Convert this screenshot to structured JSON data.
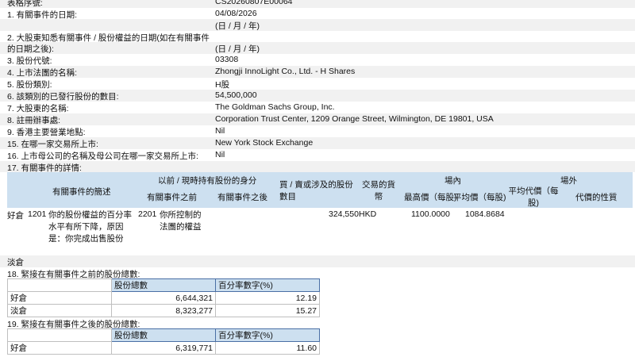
{
  "header_rows": [
    {
      "label": "表格序號:",
      "value": "CS20260807E00064"
    },
    {
      "label": "1. 有關事件的日期:",
      "value": "04/08/2026"
    },
    {
      "label": "",
      "value": "(日 / 月 / 年)"
    },
    {
      "label": "2. 大股東知悉有關事件 / 股份權益的日期(如在有關事件",
      "value": ""
    },
    {
      "label": "的日期之後):",
      "value": "(日 / 月 / 年)"
    },
    {
      "label": "3. 股份代號:",
      "value": "03308"
    },
    {
      "label": "4. 上市法團的名稱:",
      "value": "Zhongji InnoLight Co., Ltd. - H Shares"
    },
    {
      "label": "5. 股份類別:",
      "value": "H股"
    },
    {
      "label": "6. 該類別的已發行股份的數目:",
      "value": "54,500,000"
    },
    {
      "label": "7. 大股東的名稱:",
      "value": "The Goldman Sachs Group, Inc."
    },
    {
      "label": "8. 註冊辦事處:",
      "value": "Corporation Trust Center, 1209 Orange Street, Wilmington, DE 19801, USA"
    },
    {
      "label": "9. 香港主要營業地點:",
      "value": "Nil"
    },
    {
      "label": "15. 在哪一家交易所上市:",
      "value": "New York Stock Exchange"
    },
    {
      "label": "16. 上市母公司的名稱及母公司在哪一家交易所上市:",
      "value": "Nil"
    },
    {
      "label": "17. 有關事件的詳情:",
      "value": ""
    }
  ],
  "events_table": {
    "headers": {
      "desc": "有關事件的簡述",
      "capacity_group": "以前 / 現時持有股份的身分",
      "before": "有關事件之前",
      "after": "有關事件之後",
      "shares": "買 / 賣或涉及的股份數目",
      "currency": "交易的貨幣",
      "on_exchange": "場內",
      "high_price": "最高價（每股)",
      "avg_price": "平均價（每股)",
      "off_exchange": "場外",
      "off_avg": "平均代價（每股)",
      "consideration": "代價的性質"
    },
    "row": {
      "position": "好倉",
      "code1": "1201",
      "desc": "你的股份權益的百分率水平有所下降，原因是：你完成出售股份",
      "code2": "2201",
      "capacity": "你所控制的法團的權益",
      "shares": "324,550",
      "currency": "HKD",
      "high": "1100.0000",
      "avg": "1084.8684"
    },
    "short_label": "淡倉"
  },
  "section18": {
    "title": "18. 緊接在有關事件之前的股份總數:",
    "col_shares": "股份總數",
    "col_pct": "百分率數字(%)",
    "rows": [
      {
        "label": "好倉",
        "shares": "6,644,321",
        "pct": "12.19"
      },
      {
        "label": "淡倉",
        "shares": "8,323,277",
        "pct": "15.27"
      }
    ]
  },
  "section19": {
    "title": "19. 緊接在有關事件之後的股份總數:",
    "col_shares": "股份總數",
    "col_pct": "百分率數字(%)",
    "rows": [
      {
        "label": "好倉",
        "shares": "6,319,771",
        "pct": "11.60"
      }
    ]
  }
}
